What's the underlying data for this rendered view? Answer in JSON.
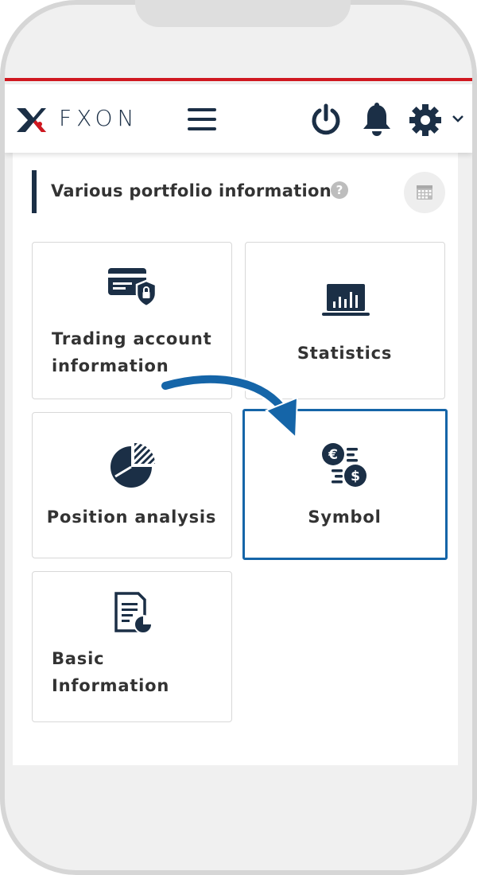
{
  "header": {
    "logo_text": "FXON",
    "icons": [
      "menu-icon",
      "power-icon",
      "bell-icon",
      "gear-icon",
      "chevron-down-icon"
    ]
  },
  "section": {
    "title": "Various portfolio information",
    "help_icon": "?"
  },
  "tiles": [
    {
      "label_line1": "Trading account",
      "label_line2": "information",
      "icon": "credit-card-shield-icon"
    },
    {
      "label": "Statistics",
      "icon": "bar-chart-icon"
    },
    {
      "label": "Position analysis",
      "icon": "pie-chart-icon"
    },
    {
      "label": "Symbol",
      "icon": "currency-exchange-icon",
      "selected": true
    },
    {
      "label_line1": "Basic",
      "label_line2": "Information",
      "icon": "document-chart-icon"
    }
  ],
  "colors": {
    "brand_navy": "#1b2f46",
    "brand_red": "#d01820",
    "highlight_blue": "#1565a8"
  }
}
